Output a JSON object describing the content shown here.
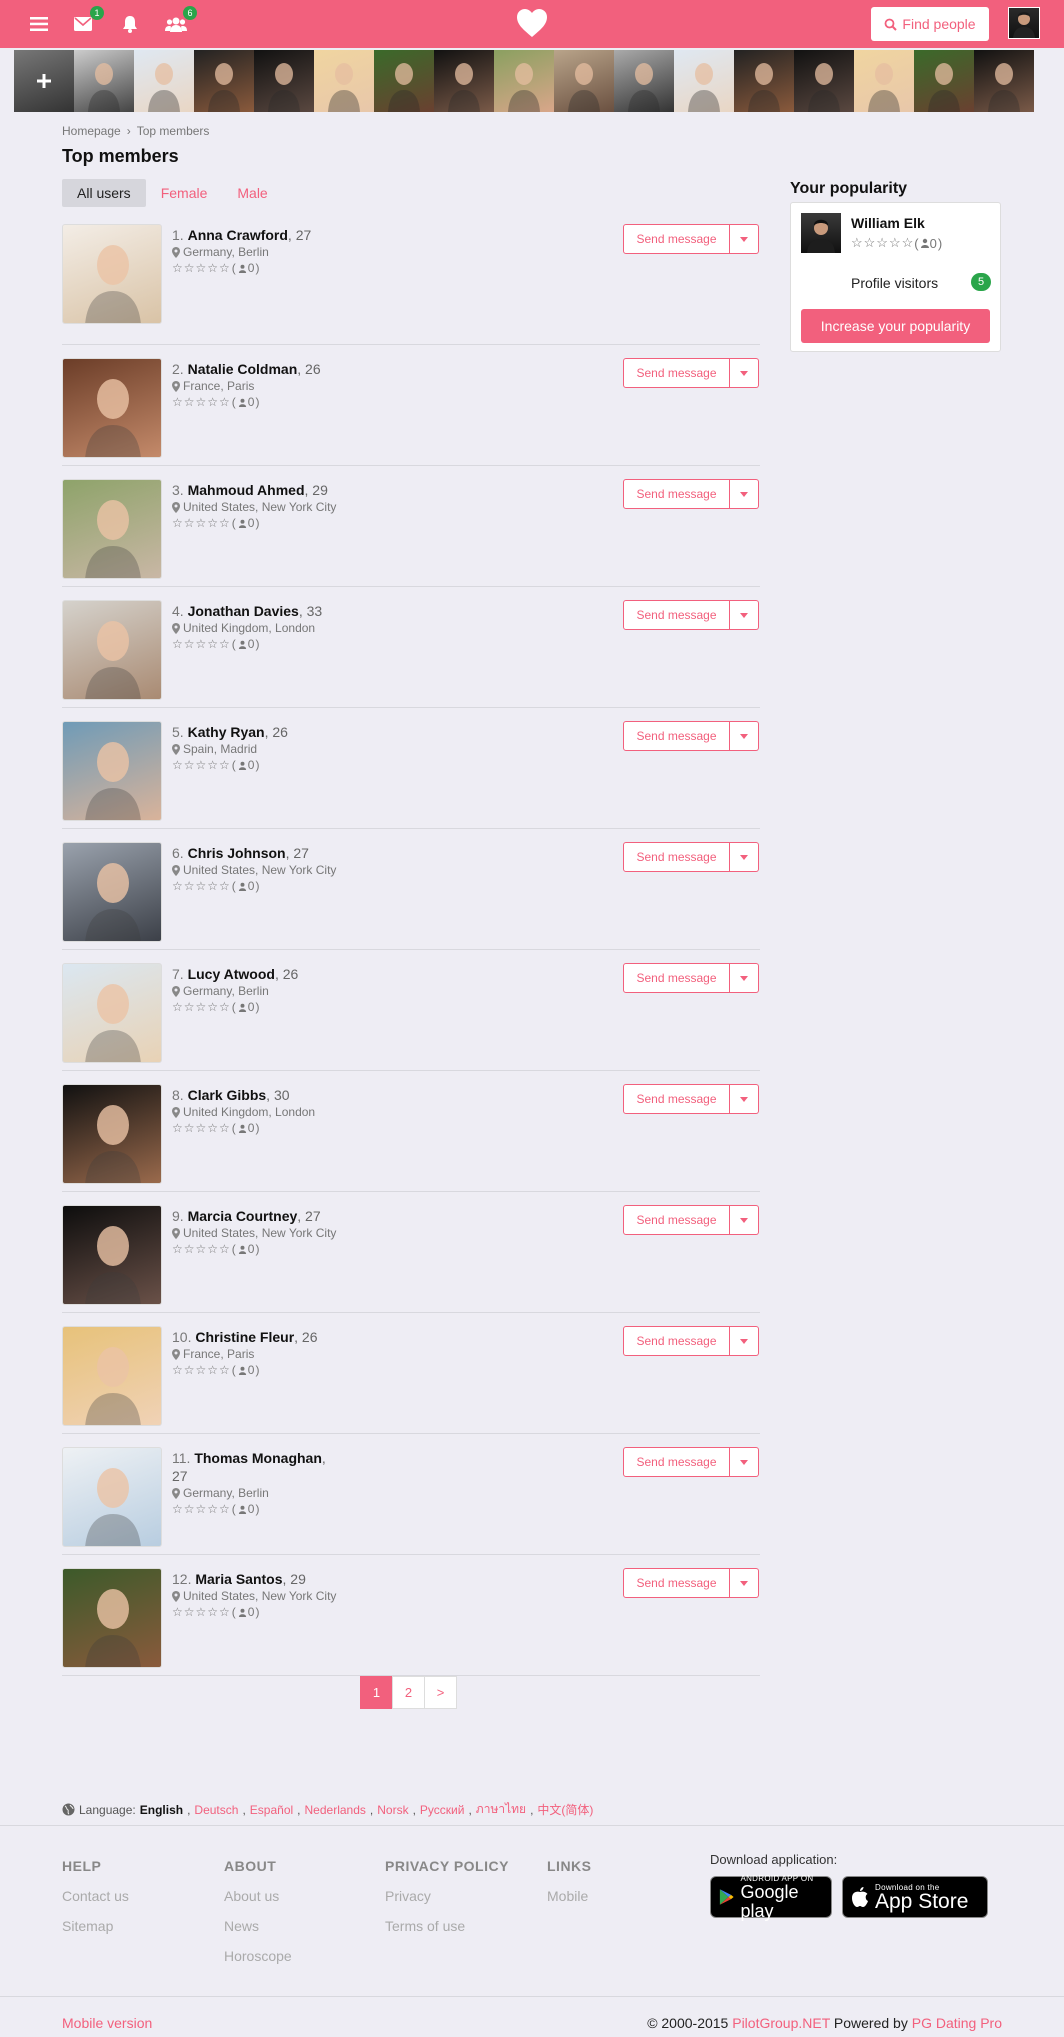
{
  "header": {
    "messages_badge": "1",
    "friends_badge": "6",
    "find_label": "Find people"
  },
  "breadcrumb": {
    "home": "Homepage",
    "current": "Top members"
  },
  "page_title": "Top members",
  "tabs": [
    {
      "label": "All users",
      "active": true
    },
    {
      "label": "Female",
      "active": false
    },
    {
      "label": "Male",
      "active": false
    }
  ],
  "members": [
    {
      "num": "1.",
      "name": "Anna Crawford",
      "age": ", 27",
      "location": "Germany, Berlin",
      "rating": "(",
      "count": " 0)",
      "bg": [
        "#f3ede6",
        "#d9c3a6"
      ]
    },
    {
      "num": "2.",
      "name": "Natalie Coldman",
      "age": ", 26",
      "location": "France, Paris",
      "rating": "(",
      "count": " 0)",
      "bg": [
        "#6b3d28",
        "#c48a6a"
      ]
    },
    {
      "num": "3.",
      "name": "Mahmoud Ahmed",
      "age": ", 29",
      "location": "United States, New York City",
      "rating": "(",
      "count": " 0)",
      "bg": [
        "#8ea36a",
        "#c9b7a5"
      ]
    },
    {
      "num": "4.",
      "name": "Jonathan Davies",
      "age": ", 33",
      "location": "United Kingdom, London",
      "rating": "(",
      "count": " 0)",
      "bg": [
        "#d5d2cc",
        "#a98a72"
      ]
    },
    {
      "num": "5.",
      "name": "Kathy Ryan",
      "age": ", 26",
      "location": "Spain, Madrid",
      "rating": "(",
      "count": " 0)",
      "bg": [
        "#6f9bb7",
        "#d9b39a"
      ]
    },
    {
      "num": "6.",
      "name": "Chris Johnson",
      "age": ", 27",
      "location": "United States, New York City",
      "rating": "(",
      "count": " 0)",
      "bg": [
        "#9aa2ad",
        "#3c4048"
      ]
    },
    {
      "num": "7.",
      "name": "Lucy Atwood",
      "age": ", 26",
      "location": "Germany, Berlin",
      "rating": "(",
      "count": " 0)",
      "bg": [
        "#dbe7f1",
        "#e8d2b5"
      ]
    },
    {
      "num": "8.",
      "name": "Clark Gibbs",
      "age": ", 30",
      "location": "United Kingdom, London",
      "rating": "(",
      "count": " 0)",
      "bg": [
        "#111111",
        "#9a6a4c"
      ]
    },
    {
      "num": "9.",
      "name": "Marcia Courtney",
      "age": ", 27",
      "location": "United States, New York City",
      "rating": "(",
      "count": " 0)",
      "bg": [
        "#0d0d0d",
        "#6a5148"
      ]
    },
    {
      "num": "10.",
      "name": "Christine Fleur",
      "age": ", 26",
      "location": "France, Paris",
      "rating": "(",
      "count": " 0)",
      "bg": [
        "#e7c27a",
        "#f0d2b6"
      ]
    },
    {
      "num": "11.",
      "name": "Thomas Monaghan",
      "age": ", 27",
      "location": "Germany, Berlin",
      "rating": "(",
      "count": " 0)",
      "bg": [
        "#eef1f4",
        "#b8cde0"
      ]
    },
    {
      "num": "12.",
      "name": "Maria Santos",
      "age": ", 29",
      "location": "United States, New York City",
      "rating": "(",
      "count": " 0)",
      "bg": [
        "#3c5a2a",
        "#8a5a3c"
      ]
    }
  ],
  "send_message_label": "Send message",
  "pagination": [
    "1",
    "2",
    ">"
  ],
  "popularity": {
    "title": "Your popularity",
    "name": "William Elk",
    "rating_count": " 0)",
    "visitors_label": "Profile visitors",
    "visitors_count": "5",
    "button": "Increase your popularity"
  },
  "language": {
    "label": "Language:",
    "current": "English",
    "others": [
      "Deutsch",
      "Español",
      "Nederlands",
      "Norsk",
      "Русский",
      "ภาษาไทย",
      "中文(简体)"
    ]
  },
  "footer": {
    "help": {
      "title": "HELP",
      "items": [
        "Contact us",
        "Sitemap"
      ]
    },
    "about": {
      "title": "ABOUT",
      "items": [
        "About us",
        "News",
        "Horoscope"
      ]
    },
    "privacy": {
      "title": "PRIVACY POLICY",
      "items": [
        "Privacy",
        "Terms of use"
      ]
    },
    "links": {
      "title": "LINKS",
      "items": [
        "Mobile"
      ]
    },
    "download_label": "Download application:",
    "google_small": "ANDROID APP ON",
    "google_big": "Google play",
    "apple_small": "Download on the",
    "apple_big": "App Store"
  },
  "bottom": {
    "mobile": "Mobile version",
    "copyright": "© 2000-2015 ",
    "company": "PilotGroup.NET",
    "powered": " Powered by ",
    "product": "PG Dating Pro"
  },
  "colors": {
    "accent": "#f2607d",
    "badge": "#2aa54a",
    "bg": "#eeedf4"
  },
  "strip_colors": [
    [
      "#777",
      "#333"
    ],
    [
      "#ccc",
      "#444"
    ],
    [
      "#dfe8f2",
      "#e9d6c4"
    ],
    [
      "#222",
      "#8a5a3c"
    ],
    [
      "#111",
      "#5a4840"
    ],
    [
      "#f0d5a0",
      "#e8c7aa"
    ],
    [
      "#3a6a2a",
      "#6a4030"
    ],
    [
      "#111",
      "#7a5a48"
    ],
    [
      "#8aa060",
      "#d9a68a"
    ],
    [
      "#b9a48a",
      "#6a5040"
    ],
    [
      "#aaa",
      "#333"
    ],
    [
      "#dfe8f2",
      "#e9d6c4"
    ],
    [
      "#222",
      "#8a5a3c"
    ],
    [
      "#111",
      "#5a4840"
    ],
    [
      "#f0d5a0",
      "#e8c7aa"
    ],
    [
      "#3a6a2a",
      "#6a4030"
    ],
    [
      "#111",
      "#7a5a48"
    ]
  ]
}
